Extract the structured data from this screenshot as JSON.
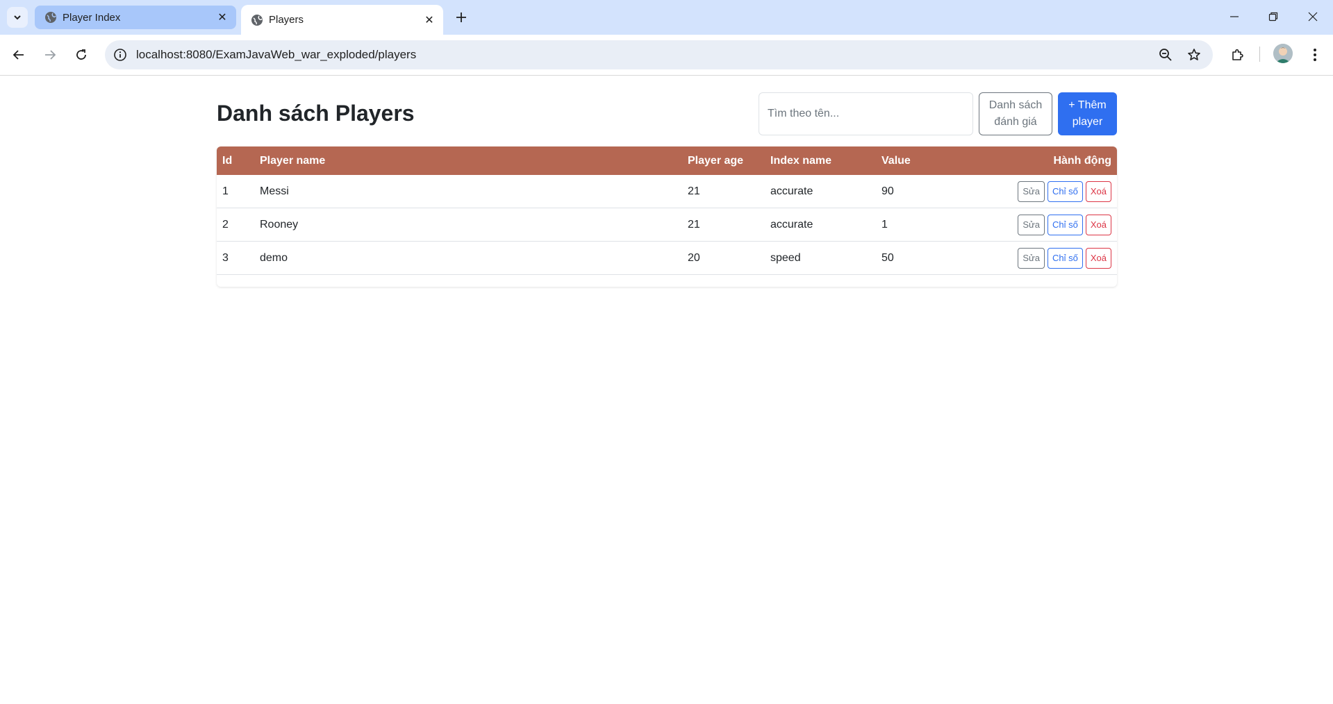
{
  "browser": {
    "tabs": [
      {
        "title": "Player Index",
        "active": false
      },
      {
        "title": "Players",
        "active": true
      }
    ],
    "url": "localhost:8080/ExamJavaWeb_war_exploded/players"
  },
  "page": {
    "title": "Danh sách Players",
    "search_placeholder": "Tìm theo tên...",
    "ratings_button": "Danh sách đánh giá",
    "add_button": "+ Thêm player"
  },
  "table": {
    "headers": {
      "id": "Id",
      "name": "Player name",
      "age": "Player age",
      "index": "Index name",
      "value": "Value",
      "actions": "Hành động"
    },
    "action_labels": {
      "edit": "Sửa",
      "stats": "Chỉ số",
      "delete": "Xoá"
    },
    "rows": [
      {
        "id": "1",
        "name": "Messi",
        "age": "21",
        "index": "accurate",
        "value": "90"
      },
      {
        "id": "2",
        "name": "Rooney",
        "age": "21",
        "index": "accurate",
        "value": "1"
      },
      {
        "id": "3",
        "name": "demo",
        "age": "20",
        "index": "speed",
        "value": "50"
      }
    ]
  },
  "colors": {
    "header_bg": "#b56752",
    "primary": "#2f6ff0",
    "danger": "#dc3545",
    "secondary": "#6c757d"
  }
}
